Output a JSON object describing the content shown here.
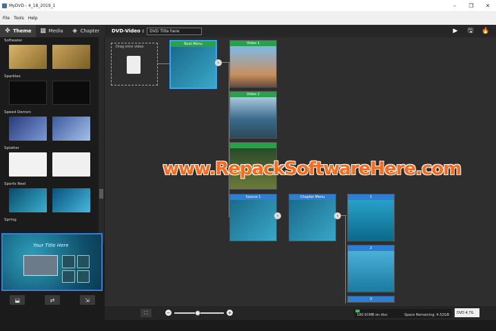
{
  "window": {
    "title": "MyDVD - 4_18_2019_1"
  },
  "menu": [
    "File",
    "Tools",
    "Help"
  ],
  "tabs": [
    {
      "label": "Theme"
    },
    {
      "label": "Media"
    },
    {
      "label": "Chapter"
    }
  ],
  "themes": [
    {
      "name": "Softwater"
    },
    {
      "name": "Sparkles"
    },
    {
      "name": "Speed Demon"
    },
    {
      "name": "Splatter"
    },
    {
      "name": "Sports Reel"
    },
    {
      "name": "Spring"
    }
  ],
  "preview": {
    "title": "Your Title Here"
  },
  "project": {
    "label": "DVD-Video :",
    "title_value": "DVD Title here"
  },
  "nodes": {
    "drop": "Drag intro video",
    "root_menu": "Root Menu",
    "video1": "Video 1",
    "video2": "Video 2",
    "source1": "Source 1",
    "chapter_menu": "Chapter Menu",
    "ch1": "1",
    "ch2": "2",
    "ch3": "3"
  },
  "watermark": "www.RepackSoftwareHere.com",
  "status": {
    "disc_used": "180.91MB on disc",
    "space_remaining": "Space Remaining: 4.52GB",
    "disc_type": "DVD 4.7G"
  }
}
